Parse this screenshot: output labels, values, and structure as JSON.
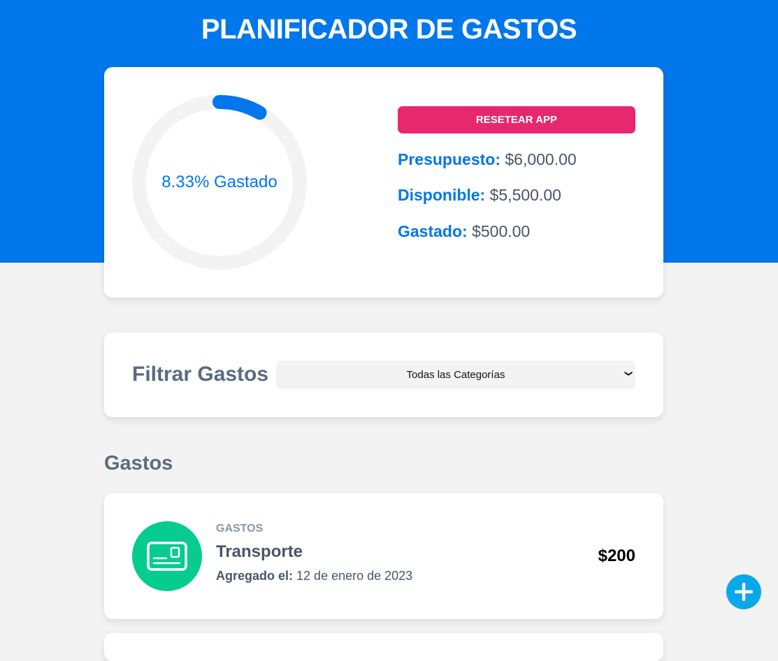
{
  "app": {
    "title": "PLANIFICADOR DE GASTOS"
  },
  "budget": {
    "spent_percent": 8.33,
    "ring_label": "8.33% Gastado",
    "reset_label": "RESETEAR APP",
    "presupuesto_label": "Presupuesto:",
    "presupuesto_value": "$6,000.00",
    "disponible_label": "Disponible:",
    "disponible_value": "$5,500.00",
    "gastado_label": "Gastado:",
    "gastado_value": "$500.00"
  },
  "filter": {
    "label": "Filtrar Gastos",
    "selected": "Todas las Categorías"
  },
  "expenses": {
    "section_title": "Gastos",
    "items": [
      {
        "category": "GASTOS",
        "name": "Transporte",
        "date_label": "Agregado el:",
        "date_value": "12 de enero de 2023",
        "amount": "$200",
        "icon": "card-icon"
      }
    ]
  },
  "colors": {
    "primary": "#0077ea",
    "reset": "#e8286c",
    "icon_bg": "#07cc8f",
    "fab": "#0aa8ea"
  }
}
